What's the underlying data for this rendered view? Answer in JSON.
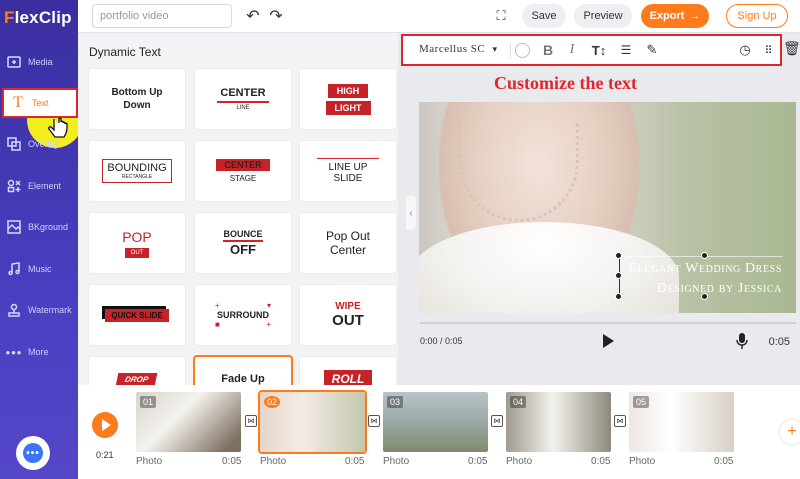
{
  "app": {
    "logo": "FlexClip"
  },
  "sidebar": {
    "items": [
      {
        "label": "Media",
        "icon": "media-icon"
      },
      {
        "label": "Text",
        "icon": "text-icon"
      },
      {
        "label": "Overlay",
        "icon": "overlay-icon"
      },
      {
        "label": "Element",
        "icon": "element-icon"
      },
      {
        "label": "BKground",
        "icon": "background-icon"
      },
      {
        "label": "Music",
        "icon": "music-icon"
      },
      {
        "label": "Watermark",
        "icon": "watermark-icon"
      },
      {
        "label": "More",
        "icon": "more-icon"
      }
    ],
    "active": "Text"
  },
  "topbar": {
    "project_placeholder": "portfolio video",
    "save_label": "Save",
    "preview_label": "Preview",
    "export_label": "Export",
    "signup_label": "Sign Up"
  },
  "panel": {
    "title": "Dynamic Text",
    "tiles": [
      {
        "text": "Bottom Up Down"
      },
      {
        "text": "CENTER",
        "sub": "LINE"
      },
      {
        "text": "HIGH",
        "sub": "LIGHT"
      },
      {
        "text": "BOUNDING",
        "sub": "RECTANGLE"
      },
      {
        "text": "CENTER",
        "sub": "STAGE"
      },
      {
        "text": "LINE UP",
        "sub": "SLIDE"
      },
      {
        "text": "POP",
        "sub": "OUT"
      },
      {
        "text": "BOUNCE",
        "sub": "OFF"
      },
      {
        "text": "Pop Out",
        "sub": "Center"
      },
      {
        "text": "QUICK SLIDE"
      },
      {
        "text": "SURROUND"
      },
      {
        "text": "WIPE",
        "sub": "OUT"
      },
      {
        "text": "DROP"
      },
      {
        "text": "Fade Up"
      },
      {
        "text": "ROLL"
      }
    ]
  },
  "text_toolbar": {
    "font": "Marcellus SC",
    "bold": "B",
    "italic": "I"
  },
  "caption": "Customize the text",
  "canvas": {
    "line1": "Elegant Wedding Dress",
    "line2": "Designed by Jessica"
  },
  "player": {
    "current": "0:00 / 0:05",
    "duration": "0:05"
  },
  "timeline": {
    "total": "0:21",
    "clips": [
      {
        "num": "01",
        "label": "Photo",
        "dur": "0:05"
      },
      {
        "num": "02",
        "label": "Photo",
        "dur": "0:05"
      },
      {
        "num": "03",
        "label": "Photo",
        "dur": "0:05"
      },
      {
        "num": "04",
        "label": "Photo",
        "dur": "0:05"
      },
      {
        "num": "05",
        "label": "Photo",
        "dur": "0:05"
      }
    ]
  },
  "colors": {
    "accent": "#ff7a1a",
    "annotation": "#e0262c",
    "sidebar": "#4a3ec0"
  }
}
